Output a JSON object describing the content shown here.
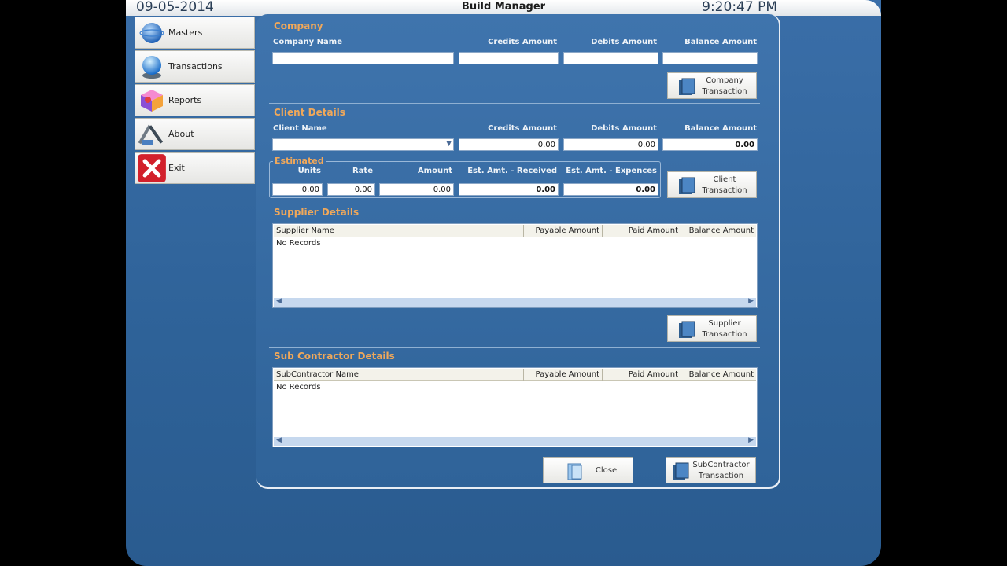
{
  "window": {
    "date": "09-05-2014",
    "title": "Build Manager",
    "time": "9:20:47 PM"
  },
  "nav": [
    {
      "label": "Masters",
      "icon": "globe-icon"
    },
    {
      "label": "Transactions",
      "icon": "orb-icon"
    },
    {
      "label": "Reports",
      "icon": "cube-icon"
    },
    {
      "label": "About",
      "icon": "tools-icon"
    },
    {
      "label": "Exit",
      "icon": "close-icon"
    }
  ],
  "company": {
    "section": "Company",
    "name_label": "Company Name",
    "credits_label": "Credits Amount",
    "debits_label": "Debits Amount",
    "balance_label": "Balance Amount",
    "name": "",
    "credits": "",
    "debits": "",
    "balance": "",
    "button": [
      "Company",
      "Transaction"
    ]
  },
  "client": {
    "section": "Client Details",
    "name_label": "Client Name",
    "credits_label": "Credits Amount",
    "debits_label": "Debits Amount",
    "balance_label": "Balance Amount",
    "name": "",
    "credits": "0.00",
    "debits": "0.00",
    "balance": "0.00",
    "estimated": {
      "title": "Estimated",
      "units_label": "Units",
      "rate_label": "Rate",
      "amount_label": "Amount",
      "received_label": "Est. Amt. - Received",
      "expences_label": "Est. Amt. - Expences",
      "units": "0.00",
      "rate": "0.00",
      "amount": "0.00",
      "received": "0.00",
      "expences": "0.00"
    },
    "button": [
      "Client",
      "Transaction"
    ]
  },
  "supplier": {
    "section": "Supplier Details",
    "columns": [
      "Supplier Name",
      "Payable Amount",
      "Paid Amount",
      "Balance Amount"
    ],
    "empty": "No Records",
    "button": [
      "Supplier",
      "Transaction"
    ]
  },
  "subcontractor": {
    "section": "Sub Contractor Details",
    "columns": [
      "SubContractor Name",
      "Payable Amount",
      "Paid Amount",
      "Balance Amount"
    ],
    "empty": "No Records",
    "button": [
      "SubContractor",
      "Transaction"
    ]
  },
  "close_label": "Close",
  "colors": {
    "accent": "#f0a85a",
    "panel": "#3a6ea8"
  }
}
